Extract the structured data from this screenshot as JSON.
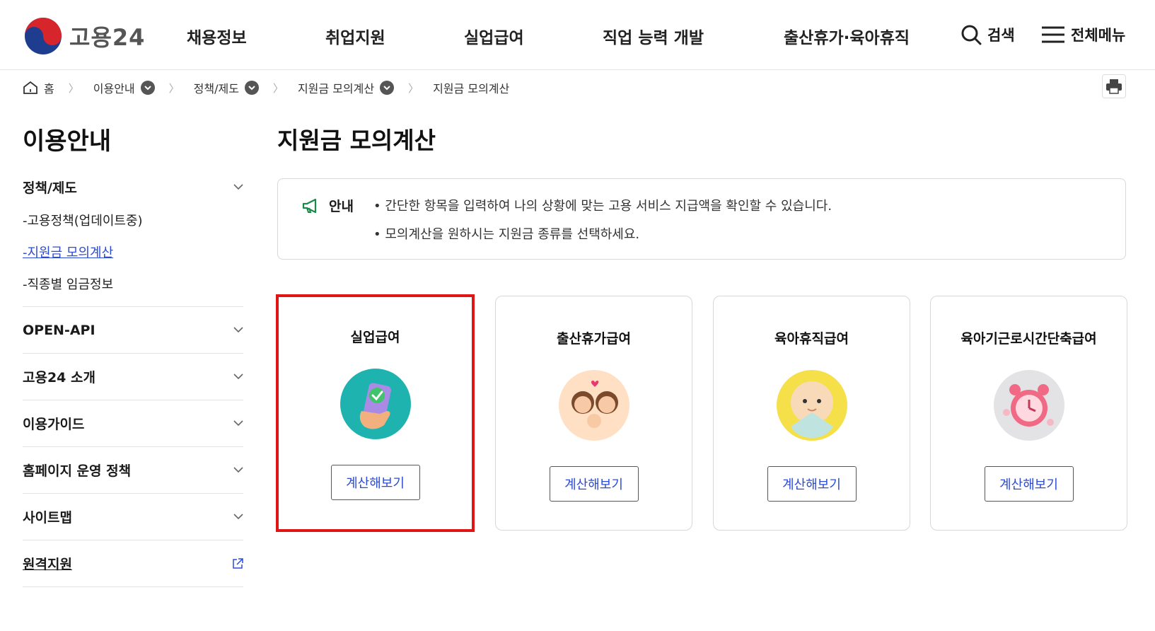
{
  "header": {
    "logo_text": "고용24",
    "nav": [
      "채용정보",
      "취업지원",
      "실업급여",
      "직업 능력 개발",
      "출산휴가·육아휴직"
    ],
    "search_label": "검색",
    "menu_label": "전체메뉴"
  },
  "breadcrumb": {
    "home": "홈",
    "items": [
      "이용안내",
      "정책/제도",
      "지원금 모의계산"
    ],
    "current": "지원금 모의계산"
  },
  "sidebar": {
    "title": "이용안내",
    "sections": [
      {
        "label": "정책/제도",
        "sub": [
          "-고용정책(업데이트중)",
          "-지원금 모의계산",
          "-직종별 임금정보"
        ]
      },
      {
        "label": "OPEN-API"
      },
      {
        "label": "고용24 소개"
      },
      {
        "label": "이용가이드"
      },
      {
        "label": "홈페이지 운영 정책"
      },
      {
        "label": "사이트맵"
      },
      {
        "label": "원격지원"
      }
    ]
  },
  "main": {
    "title": "지원금 모의계산",
    "notice": {
      "label": "안내",
      "lines": [
        "간단한 항목을 입력하여 나의 상황에 맞는 고용 서비스 지급액을 확인할 수 있습니다.",
        "모의계산을 원하시는 지원금 종류를 선택하세요."
      ]
    },
    "cards": [
      {
        "title": "실업급여",
        "icon": "phone-check-icon",
        "button": "계산해보기",
        "selected": true
      },
      {
        "title": "출산휴가급여",
        "icon": "family-icon",
        "button": "계산해보기"
      },
      {
        "title": "육아휴직급여",
        "icon": "baby-icon",
        "button": "계산해보기"
      },
      {
        "title": "육아기근로시간단축급여",
        "icon": "alarm-clock-icon",
        "button": "계산해보기"
      }
    ]
  },
  "colors": {
    "accent": "#2a4bd8",
    "highlight_border": "#e01515",
    "notice_icon": "#1a8a4a"
  }
}
